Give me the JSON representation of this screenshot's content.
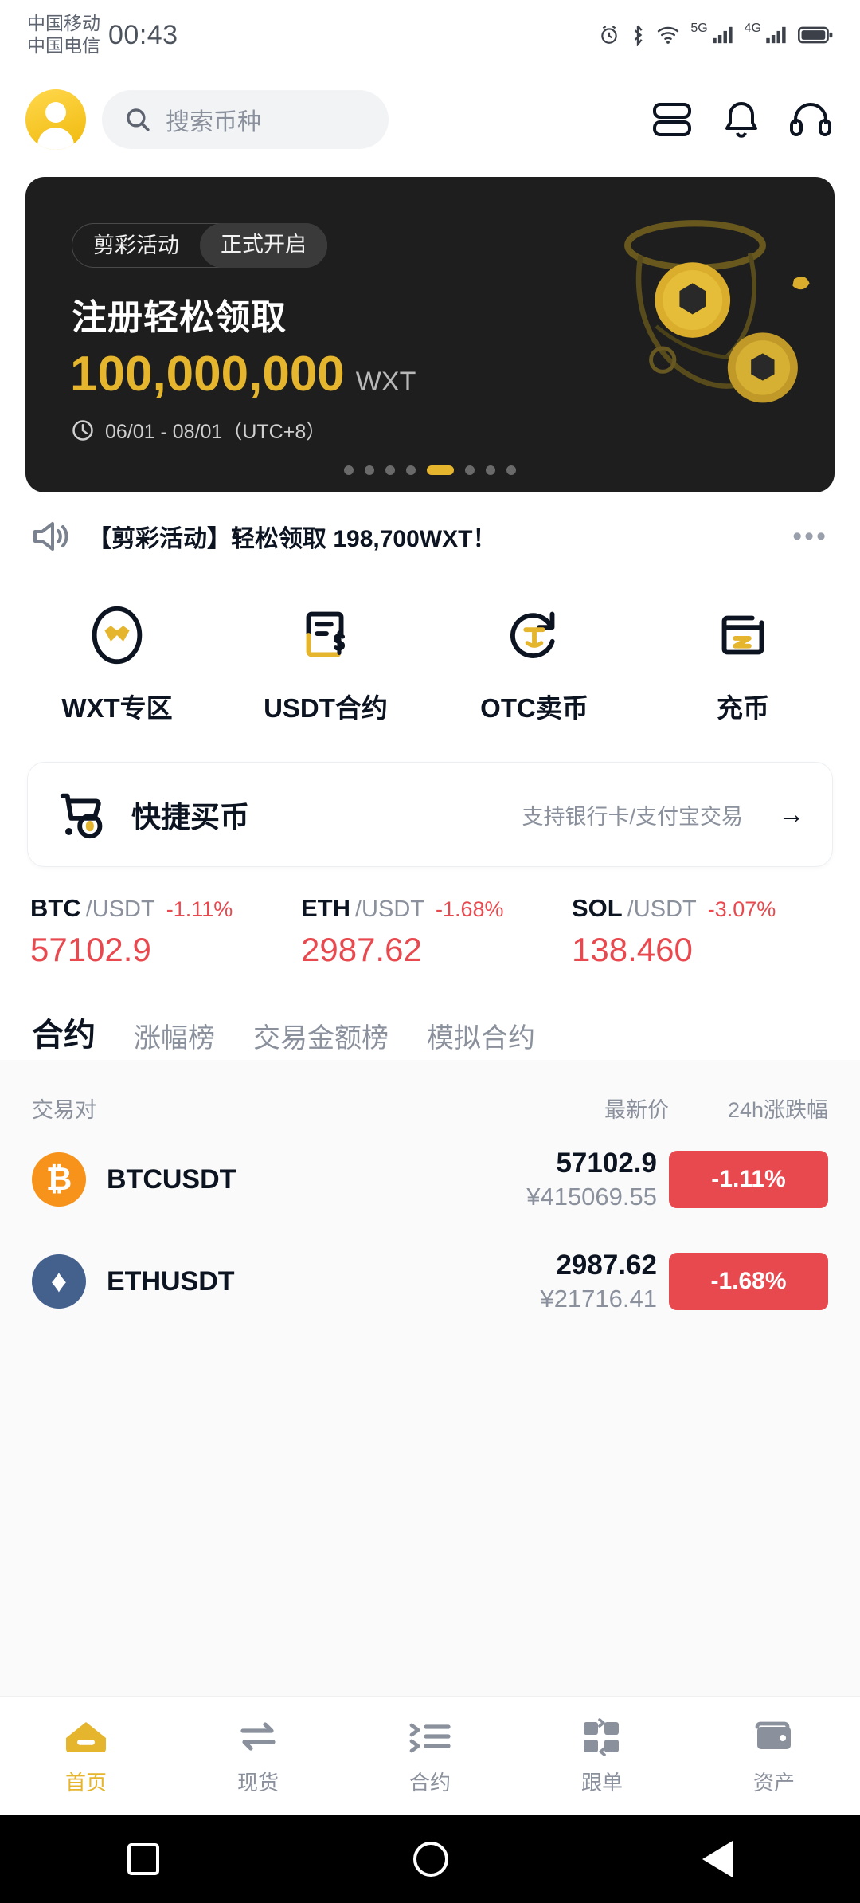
{
  "statusbar": {
    "carrier1": "中国移动",
    "carrier2": "中国电信",
    "time": "00:43",
    "net1": "5G",
    "net2": "4G",
    "icons": [
      "alarm-icon",
      "bluetooth-icon",
      "wifi-icon",
      "signal-5g-icon",
      "signal-4g-icon",
      "battery-icon"
    ]
  },
  "header": {
    "search_placeholder": "搜索币种",
    "avatar_name": "user-avatar",
    "icons": [
      "scan-icon",
      "notification-bell-icon",
      "customer-service-icon"
    ]
  },
  "banner": {
    "tag_left": "剪彩活动",
    "tag_right": "正式开启",
    "title": "注册轻松领取",
    "amount": "100,000,000",
    "unit": "WXT",
    "date_range": "06/01 - 08/01（UTC+8）",
    "dots_total": 8,
    "dots_active_index": 4
  },
  "notice": {
    "text": "【剪彩活动】轻松领取 198,700WXT！",
    "more": "•••"
  },
  "quick_actions": [
    {
      "label": "WXT专区",
      "icon": "wxt-zone-icon"
    },
    {
      "label": "USDT合约",
      "icon": "usdt-contract-icon"
    },
    {
      "label": "OTC卖币",
      "icon": "otc-sell-icon"
    },
    {
      "label": "充币",
      "icon": "deposit-icon"
    }
  ],
  "buy_card": {
    "title": "快捷买币",
    "subtitle": "支持银行卡/支付宝交易",
    "arrow": "→",
    "icon": "shopping-cart-icon"
  },
  "mini_tickers": [
    {
      "base": "BTC",
      "quote": "/USDT",
      "change": "-1.11%",
      "price": "57102.9"
    },
    {
      "base": "ETH",
      "quote": "/USDT",
      "change": "-1.68%",
      "price": "2987.62"
    },
    {
      "base": "SOL",
      "quote": "/USDT",
      "change": "-3.07%",
      "price": "138.460"
    }
  ],
  "tabs": [
    {
      "label": "合约",
      "active": true
    },
    {
      "label": "涨幅榜",
      "active": false
    },
    {
      "label": "交易金额榜",
      "active": false
    },
    {
      "label": "模拟合约",
      "active": false
    }
  ],
  "market": {
    "columns": {
      "pair": "交易对",
      "price": "最新价",
      "change": "24h涨跌幅"
    },
    "rows": [
      {
        "symbol": "BTCUSDT",
        "coin": "btc",
        "glyph": "₿",
        "price_usd": "57102.9",
        "price_cny": "¥415069.55",
        "change": "-1.11%"
      },
      {
        "symbol": "ETHUSDT",
        "coin": "eth",
        "glyph": "♦",
        "price_usd": "2987.62",
        "price_cny": "¥21716.41",
        "change": "-1.68%"
      }
    ]
  },
  "bottom_nav": [
    {
      "label": "首页",
      "icon": "home-icon",
      "active": true
    },
    {
      "label": "现货",
      "icon": "spot-exchange-icon",
      "active": false
    },
    {
      "label": "合约",
      "icon": "contract-icon",
      "active": false
    },
    {
      "label": "跟单",
      "icon": "copy-trade-icon",
      "active": false
    },
    {
      "label": "资产",
      "icon": "wallet-icon",
      "active": false
    }
  ],
  "colors": {
    "brand_gold": "#e5b52e",
    "down_red": "#e8494f",
    "banner_bg": "#1e1e1e",
    "table_bg": "#fafafa"
  }
}
